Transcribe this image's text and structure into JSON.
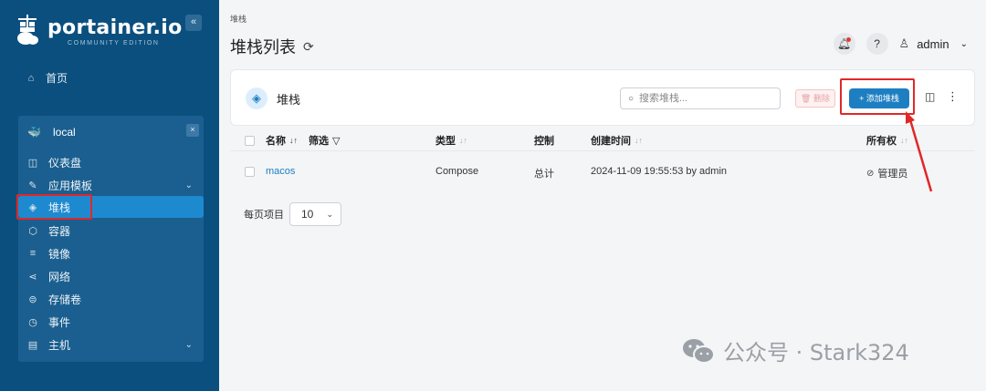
{
  "sidebar": {
    "brand_name": "portainer.io",
    "brand_sub": "COMMUNITY EDITION",
    "collapse_label": "«",
    "home_label": "首页",
    "environment": {
      "name": "local",
      "close_label": "×",
      "items": [
        {
          "label": "仪表盘",
          "icon": "dashboard-icon",
          "glyph": "◫",
          "has_chevron": false
        },
        {
          "label": "应用模板",
          "icon": "edit-icon",
          "glyph": "✎",
          "has_chevron": true
        },
        {
          "label": "堆栈",
          "icon": "layers-icon",
          "glyph": "◈",
          "has_chevron": false,
          "active": true
        },
        {
          "label": "容器",
          "icon": "box-icon",
          "glyph": "⬡",
          "has_chevron": false
        },
        {
          "label": "镜像",
          "icon": "list-icon",
          "glyph": "≡",
          "has_chevron": false
        },
        {
          "label": "网络",
          "icon": "share-icon",
          "glyph": "⋖",
          "has_chevron": false
        },
        {
          "label": "存储卷",
          "icon": "database-icon",
          "glyph": "⊜",
          "has_chevron": false
        },
        {
          "label": "事件",
          "icon": "history-icon",
          "glyph": "◷",
          "has_chevron": false
        },
        {
          "label": "主机",
          "icon": "server-icon",
          "glyph": "▤",
          "has_chevron": true
        }
      ]
    }
  },
  "header": {
    "breadcrumb": "堆栈",
    "title": "堆栈列表",
    "user": "admin"
  },
  "panel": {
    "title": "堆栈",
    "search_placeholder": "搜索堆栈...",
    "delete_label": "🗑 删除",
    "add_label": "+ 添加堆栈"
  },
  "table": {
    "headers": {
      "name": "名称",
      "filter": "筛选",
      "type": "类型",
      "control": "控制",
      "created": "创建时间",
      "ownership": "所有权"
    },
    "rows": [
      {
        "name": "macos",
        "type": "Compose",
        "control": "总计",
        "created": "2024-11-09 19:55:53 by admin",
        "ownership": "管理员"
      }
    ]
  },
  "pager": {
    "label": "每页项目",
    "value": "10"
  },
  "watermark": "公众号 · Stark324",
  "colors": {
    "sidebar": "#0b4f7e",
    "accent": "#1d7fc2",
    "highlight": "#e02828"
  }
}
